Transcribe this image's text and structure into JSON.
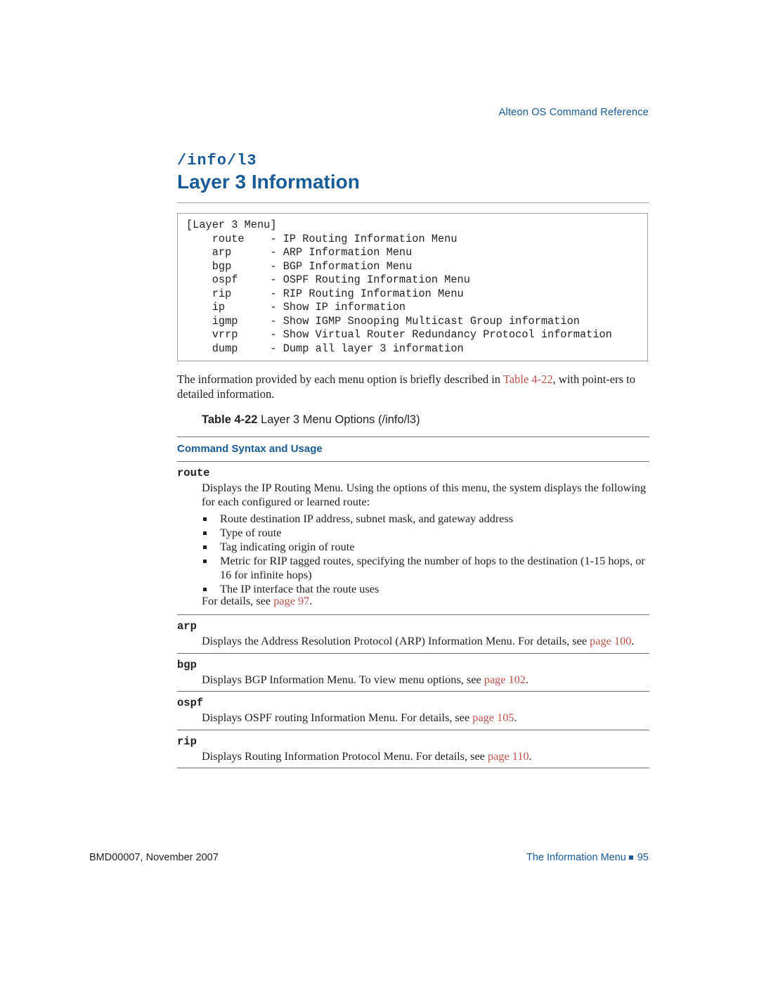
{
  "header": {
    "right_text": "Alteon OS  Command Reference"
  },
  "command": {
    "path": "/info/l3",
    "title": "Layer 3 Information"
  },
  "code_block": {
    "text": "[Layer 3 Menu]\n    route    - IP Routing Information Menu\n    arp      - ARP Information Menu\n    bgp      - BGP Information Menu\n    ospf     - OSPF Routing Information Menu\n    rip      - RIP Routing Information Menu\n    ip       - Show IP information\n    igmp     - Show IGMP Snooping Multicast Group information\n    vrrp     - Show Virtual Router Redundancy Protocol information\n    dump     - Dump all layer 3 information"
  },
  "intro": {
    "part1": "The information provided by each menu option is briefly described in ",
    "link": "Table 4-22",
    "part2": ", with point-ers to detailed information."
  },
  "table": {
    "caption_label": "Table 4-22",
    "caption_text": " Layer 3 Menu Options (/info/l3)",
    "column_header": "Command Syntax and Usage",
    "rows": [
      {
        "term": "route",
        "desc": "Displays the IP Routing Menu. Using the options of this menu, the system displays the following for each configured or learned route:",
        "bullets": [
          "Route destination IP address, subnet mask, and gateway address",
          "Type of route",
          "Tag indicating origin of route",
          "Metric for RIP tagged routes, specifying the number of hops to the destination (1-15 hops, or 16 for infinite hops)",
          "The IP interface that the route uses"
        ],
        "footer_prefix": "For details, see ",
        "footer_link": "page",
        "footer_page": " 97",
        "footer_suffix": "."
      },
      {
        "term": "arp",
        "desc_prefix": "Displays the Address Resolution Protocol (ARP) Information Menu. For details, see ",
        "desc_link": "page",
        "desc_page": " 100",
        "desc_suffix": "."
      },
      {
        "term": "bgp",
        "desc_prefix": "Displays BGP Information Menu. To view menu options, see ",
        "desc_link": "page",
        "desc_page": " 102",
        "desc_suffix": "."
      },
      {
        "term": "ospf",
        "desc_prefix": "Displays OSPF routing Information Menu. For details, see ",
        "desc_link": "page",
        "desc_page": " 105",
        "desc_suffix": "."
      },
      {
        "term": "rip",
        "desc_prefix": "Displays Routing Information Protocol Menu. For details, see ",
        "desc_link": "page",
        "desc_page": " 110",
        "desc_suffix": "."
      }
    ]
  },
  "footer": {
    "left": "BMD00007, November 2007",
    "right_text": "The Information Menu",
    "page_number": "95"
  }
}
